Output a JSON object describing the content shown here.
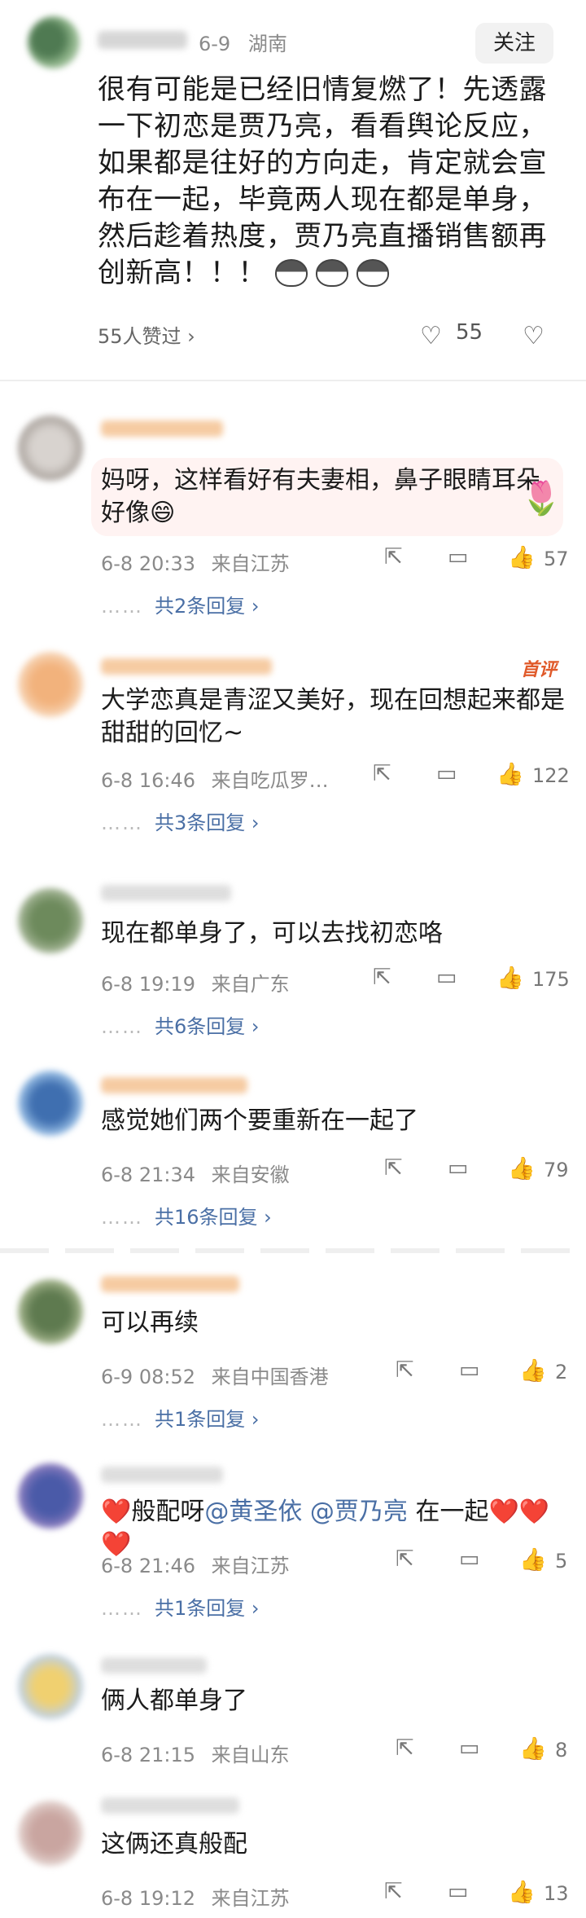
{
  "post": {
    "date": "6-9",
    "location": "湖南",
    "follow_label": "关注",
    "text": "很有可能是已经旧情复燃了！先透露一下初恋是贾乃亮，看看舆论反应，如果都是往好的方向走，肯定就会宣布在一起，毕竟两人现在都是单身，然后趁着热度，贾乃亮直播销售额再创新高！！！",
    "liked_by": "55人赞过 ›",
    "like_count": "55",
    "icons": [
      "heart-icon",
      "broken-heart-icon",
      "cat-emoji"
    ]
  },
  "comments": [
    {
      "text": "妈呀，这样看好有夫妻相，鼻子眼睛耳朵好像😄",
      "date": "6-8 20:33",
      "location": "来自江苏",
      "likes": "57",
      "replies": "共2条回复 ›"
    },
    {
      "text": "大学恋真是青涩又美好，现在回想起来都是甜甜的回忆~",
      "date": "6-8 16:46",
      "location": "来自吃瓜罗…",
      "likes": "122",
      "replies": "共3条回复 ›",
      "badge": "首评"
    },
    {
      "text": "现在都单身了，可以去找初恋咯",
      "date": "6-8 19:19",
      "location": "来自广东",
      "likes": "175",
      "replies": "共6条回复 ›"
    },
    {
      "text": "感觉她们两个要重新在一起了",
      "date": "6-8 21:34",
      "location": "来自安徽",
      "likes": "79",
      "replies": "共16条回复 ›"
    },
    {
      "text": "可以再续",
      "date": "6-9 08:52",
      "location": "来自中国香港",
      "likes": "2",
      "replies": "共1条回复 ›"
    },
    {
      "text_prefix": "❤️般配呀",
      "mention1": "@黄圣依",
      "mention2": "@贾乃亮",
      "text_suffix": " 在一起❤️❤️❤️",
      "date": "6-8 21:46",
      "location": "来自江苏",
      "likes": "5",
      "replies": "共1条回复 ›"
    },
    {
      "text": "俩人都单身了",
      "date": "6-8 21:15",
      "location": "来自山东",
      "likes": "8"
    },
    {
      "text": "这俩还真般配",
      "date": "6-8 19:12",
      "location": "来自江苏",
      "likes": "13"
    }
  ],
  "action_icons": [
    "share-icon",
    "comment-icon",
    "thumbs-up-icon"
  ],
  "reply_dots": "……"
}
